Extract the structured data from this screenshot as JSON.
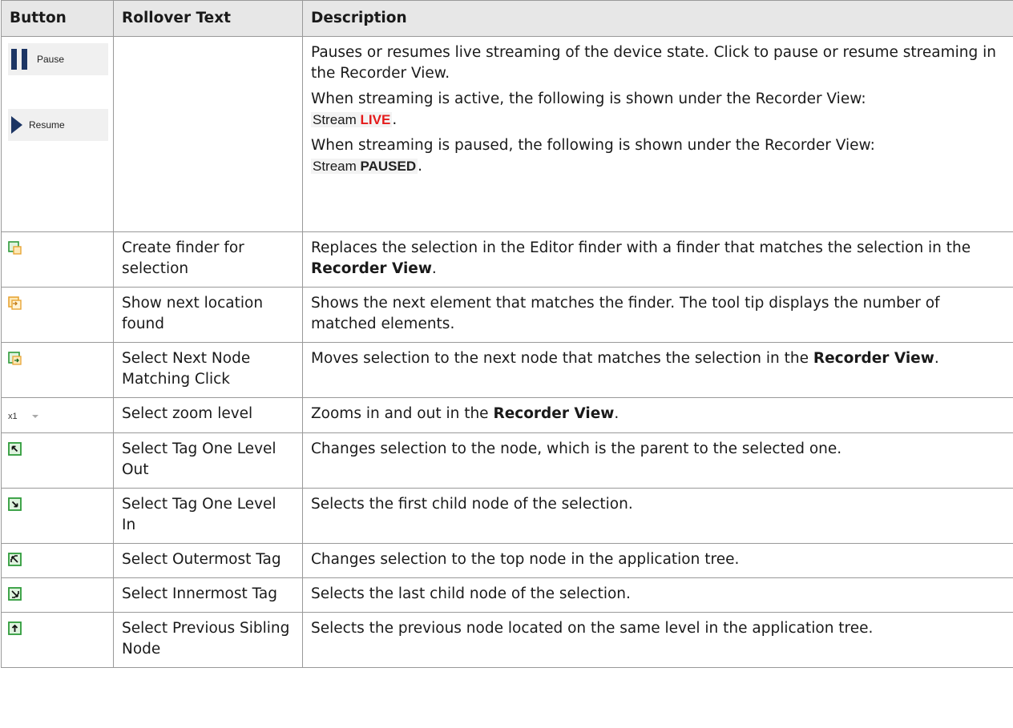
{
  "header": {
    "col_button": "Button",
    "col_rollover": "Rollover Text",
    "col_description": "Description"
  },
  "pause_row": {
    "pause_label": "Pause",
    "resume_label": "Resume",
    "rollover": "",
    "desc1": "Pauses or resumes live streaming of the device state. Click to pause or resume streaming in the Recorder View.",
    "desc2": "When streaming is active, the following is shown under the Recorder View:",
    "stream_word": "Stream",
    "live_word": "LIVE",
    "desc3": "When streaming is paused, the following is shown under the Recorder View:",
    "paused_word": "PAUSED",
    "period": "."
  },
  "rows": [
    {
      "rollover": "Create finder for selection",
      "desc_pre": "Replaces the selection in the Editor finder with a finder that matches the selection in the ",
      "desc_bold": "Recorder View",
      "desc_post": ".",
      "icon": "create-finder-icon"
    },
    {
      "rollover": "Show next location found",
      "desc_pre": "Shows the next element that matches the finder. The tool tip displays the number of matched elements.",
      "desc_bold": "",
      "desc_post": "",
      "icon": "next-location-icon"
    },
    {
      "rollover": "Select Next Node Matching Click",
      "desc_pre": "Moves selection to the next node that matches the selection in the ",
      "desc_bold": "Recorder View",
      "desc_post": ".",
      "icon": "next-node-icon"
    },
    {
      "rollover": "Select zoom level",
      "desc_pre": "Zooms in and out in the ",
      "desc_bold": "Recorder View",
      "desc_post": ".",
      "icon": "zoom-select",
      "zoom_value": "x1"
    },
    {
      "rollover": "Select Tag One Level Out",
      "desc_pre": "Changes selection to the node, which is the parent to the selected one.",
      "desc_bold": "",
      "desc_post": "",
      "icon": "level-out-icon"
    },
    {
      "rollover": "Select Tag One Level In",
      "desc_pre": "Selects the first child node of the selection.",
      "desc_bold": "",
      "desc_post": "",
      "icon": "level-in-icon"
    },
    {
      "rollover": "Select Outermost Tag",
      "desc_pre": "Changes selection to the top node in the application tree.",
      "desc_bold": "",
      "desc_post": "",
      "icon": "outermost-icon"
    },
    {
      "rollover": "Select Innermost Tag",
      "desc_pre": "Selects the last child node of the selection.",
      "desc_bold": "",
      "desc_post": "",
      "icon": "innermost-icon"
    },
    {
      "rollover": "Select Previous Sibling Node",
      "desc_pre": "Selects the previous node located on the same level in the application tree.",
      "desc_bold": "",
      "desc_post": "",
      "icon": "previous-sibling-icon"
    }
  ],
  "colors": {
    "header_bg": "#e7e7e7",
    "border": "#999999",
    "icon_green": "#2e9b3a",
    "icon_orange": "#e8a535",
    "pause_blue": "#1c3564",
    "live_red": "#e51b1b"
  }
}
